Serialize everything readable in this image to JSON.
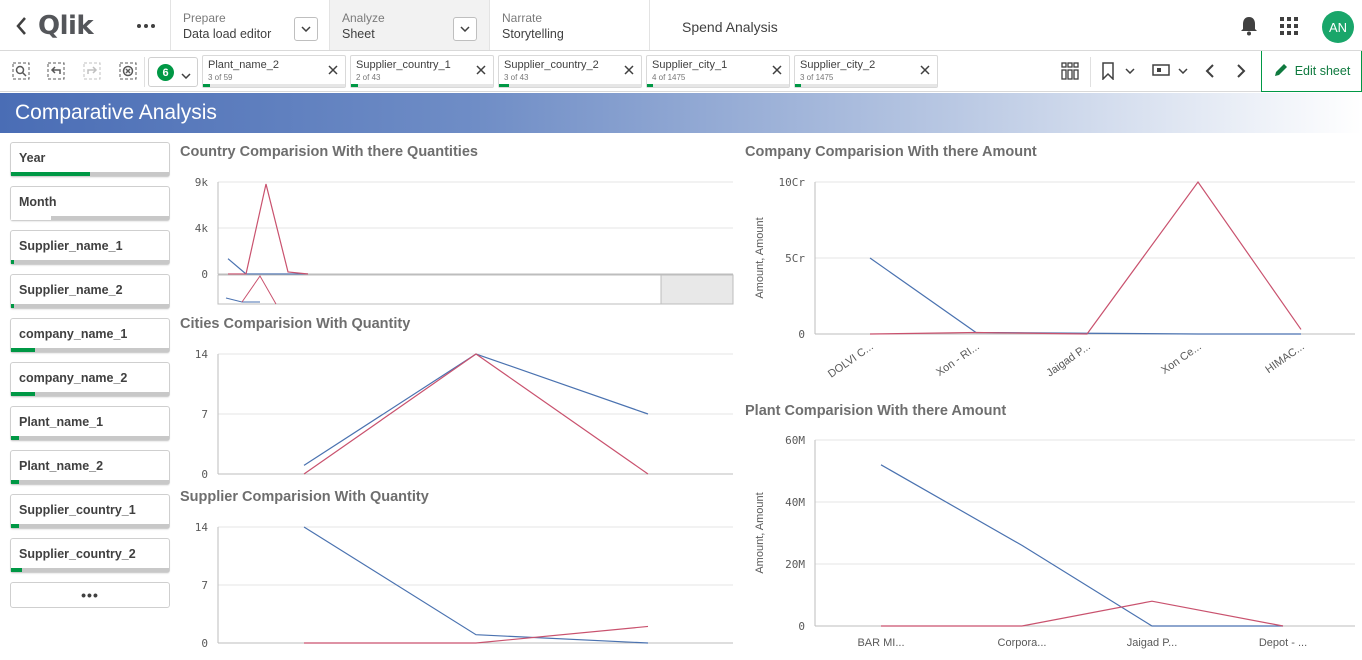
{
  "nav": {
    "logo": "Qlik",
    "prepare": {
      "label": "Prepare",
      "value": "Data load editor"
    },
    "analyze": {
      "label": "Analyze",
      "value": "Sheet"
    },
    "narrate": {
      "label": "Narrate",
      "value": "Storytelling"
    },
    "app_title": "Spend Analysis",
    "avatar": "AN"
  },
  "toolbar": {
    "selection_count": "6",
    "chips": [
      {
        "name": "Plant_name_2",
        "count": "3 of 59",
        "fill": 0.05
      },
      {
        "name": "Supplier_country_1",
        "count": "2 of 43",
        "fill": 0.05
      },
      {
        "name": "Supplier_country_2",
        "count": "3 of 43",
        "fill": 0.07
      },
      {
        "name": "Supplier_city_1",
        "count": "4 of 1475",
        "fill": 0.01
      },
      {
        "name": "Supplier_city_2",
        "count": "3 of 1475",
        "fill": 0.01
      }
    ],
    "edit_label": "Edit sheet"
  },
  "sheet_title": "Comparative Analysis",
  "filters": [
    {
      "label": "Year",
      "fill": 0.5
    },
    {
      "label": "Month",
      "fill": 0.0
    },
    {
      "label": "Supplier_name_1",
      "fill": 0.02
    },
    {
      "label": "Supplier_name_2",
      "fill": 0.02
    },
    {
      "label": "company_name_1",
      "fill": 0.15
    },
    {
      "label": "company_name_2",
      "fill": 0.15
    },
    {
      "label": "Plant_name_1",
      "fill": 0.05
    },
    {
      "label": "Plant_name_2",
      "fill": 0.05
    },
    {
      "label": "Supplier_country_1",
      "fill": 0.05
    },
    {
      "label": "Supplier_country_2",
      "fill": 0.07
    }
  ],
  "more_filters": "•••",
  "colors": {
    "series_a": "#4a72b0",
    "series_b": "#c9526e",
    "accent": "#009845"
  },
  "chart_data": [
    {
      "id": "country",
      "type": "line",
      "title": "Country Comparision With there Quantities",
      "yticks": [
        "9k",
        "4k",
        "0"
      ],
      "ylim": [
        0,
        9000
      ],
      "x": [
        0,
        1,
        2,
        3,
        4
      ],
      "series": [
        {
          "values": [
            1500,
            0,
            0,
            0,
            0
          ]
        },
        {
          "values": [
            0,
            0,
            8800,
            200,
            0
          ]
        }
      ]
    },
    {
      "id": "cities",
      "type": "line",
      "title": "Cities Comparision With Quantity",
      "yticks": [
        "14",
        "7",
        "0"
      ],
      "ylim": [
        0,
        14
      ],
      "x": [
        0,
        1,
        2
      ],
      "series": [
        {
          "values": [
            1,
            14,
            7
          ]
        },
        {
          "values": [
            0,
            14,
            0
          ]
        }
      ]
    },
    {
      "id": "supplier",
      "type": "line",
      "title": "Supplier Comparision With Quantity",
      "yticks": [
        "14",
        "7",
        "0"
      ],
      "ylim": [
        0,
        14
      ],
      "x": [
        0,
        1,
        2
      ],
      "series": [
        {
          "values": [
            14,
            1,
            0
          ]
        },
        {
          "values": [
            0,
            0,
            2
          ]
        }
      ]
    },
    {
      "id": "company",
      "type": "line",
      "title": "Company Comparision With there Amount",
      "ylabel": "Amount, Amount",
      "yticks": [
        "10Cr",
        "5Cr",
        "0"
      ],
      "ylim": [
        0,
        10
      ],
      "categories": [
        "DOLVI C...",
        "Xon - RI...",
        "Jaigad P...",
        "Xon Ce...",
        "HIMAC..."
      ],
      "series": [
        {
          "values": [
            5,
            0.1,
            0.05,
            0,
            0
          ]
        },
        {
          "values": [
            0,
            0.1,
            0,
            10,
            0.3
          ]
        }
      ]
    },
    {
      "id": "plant",
      "type": "line",
      "title": "Plant Comparision With there Amount",
      "ylabel": "Amount, Amount",
      "yticks": [
        "60M",
        "40M",
        "20M",
        "0"
      ],
      "ylim": [
        0,
        60
      ],
      "categories": [
        "BAR MI...",
        "Corpora...",
        "Jaigad P...",
        "Depot - ..."
      ],
      "series": [
        {
          "values": [
            52,
            26,
            0,
            0
          ]
        },
        {
          "values": [
            0,
            0,
            8,
            0
          ]
        }
      ]
    }
  ]
}
